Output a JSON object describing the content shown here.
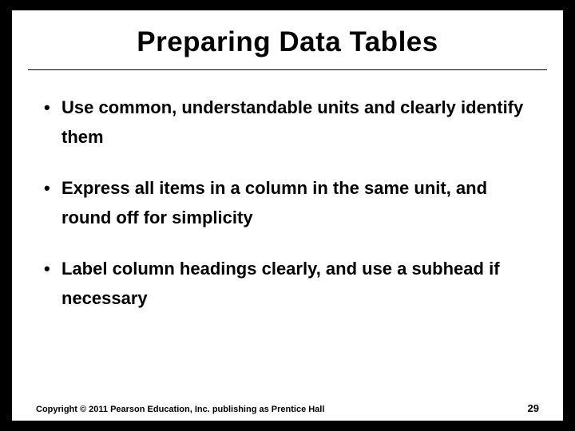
{
  "title": "Preparing Data Tables",
  "bullets": [
    "Use common, understandable units and clearly identify them",
    "Express all items in a column in the same unit, and round off for simplicity",
    "Label column headings clearly, and use a subhead if necessary"
  ],
  "copyright": "Copyright © 2011 Pearson Education, Inc. publishing as Prentice Hall",
  "page_number": "29"
}
